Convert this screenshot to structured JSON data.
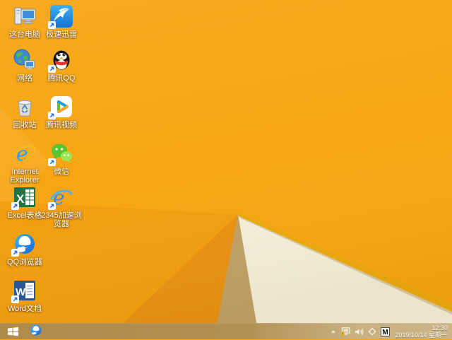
{
  "wallpaper": {
    "base_color": "#F7A512",
    "facet_left": "#F19E10",
    "facet_wedge": "#E89110",
    "facet_tan": "#BFA066",
    "facet_cream": "#F4EEDA",
    "fold_edge_gold": "#ECA90D"
  },
  "desktop": {
    "icons": [
      {
        "label": "这台电脑",
        "glyph": "this-pc",
        "col": 1,
        "row": 1,
        "shortcut": false
      },
      {
        "label": "极速迅雷",
        "glyph": "thunder",
        "col": 2,
        "row": 1,
        "shortcut": true
      },
      {
        "label": "网络",
        "glyph": "network",
        "col": 1,
        "row": 2,
        "shortcut": false
      },
      {
        "label": "腾讯QQ",
        "glyph": "qq",
        "col": 2,
        "row": 2,
        "shortcut": true
      },
      {
        "label": "回收站",
        "glyph": "recycle-bin",
        "col": 1,
        "row": 3,
        "shortcut": false
      },
      {
        "label": "腾讯视频",
        "glyph": "tencent-video",
        "col": 2,
        "row": 3,
        "shortcut": true
      },
      {
        "label": "Internet Explorer",
        "glyph": "internet-explorer",
        "col": 1,
        "row": 4,
        "shortcut": false
      },
      {
        "label": "微信",
        "glyph": "wechat",
        "col": 2,
        "row": 4,
        "shortcut": true
      },
      {
        "label": "Excel表格",
        "glyph": "excel",
        "col": 1,
        "row": 5,
        "shortcut": true
      },
      {
        "label": "2345加速浏览器",
        "glyph": "browser-2345",
        "col": 2,
        "row": 5,
        "shortcut": true
      },
      {
        "label": "QQ浏览器",
        "glyph": "qq-browser",
        "col": 1,
        "row": 6,
        "shortcut": true
      },
      {
        "label": "Word文档",
        "glyph": "word",
        "col": 1,
        "row": 7,
        "shortcut": true
      }
    ]
  },
  "taskbar": {
    "start_button": {
      "name": "start"
    },
    "pinned": [
      {
        "name": "qq-browser",
        "glyph": "qq-browser-task"
      }
    ],
    "tray": [
      {
        "name": "show-hidden-icons",
        "glyph": "chevron-up"
      },
      {
        "name": "network-status",
        "glyph": "network-warning"
      },
      {
        "name": "volume",
        "glyph": "speaker"
      },
      {
        "name": "tray-utility",
        "glyph": "crosshair"
      },
      {
        "name": "input-method",
        "glyph": "ime-m",
        "label": "M"
      }
    ],
    "clock": {
      "time": "12:30",
      "date": "2019/10/14 星期一"
    }
  }
}
